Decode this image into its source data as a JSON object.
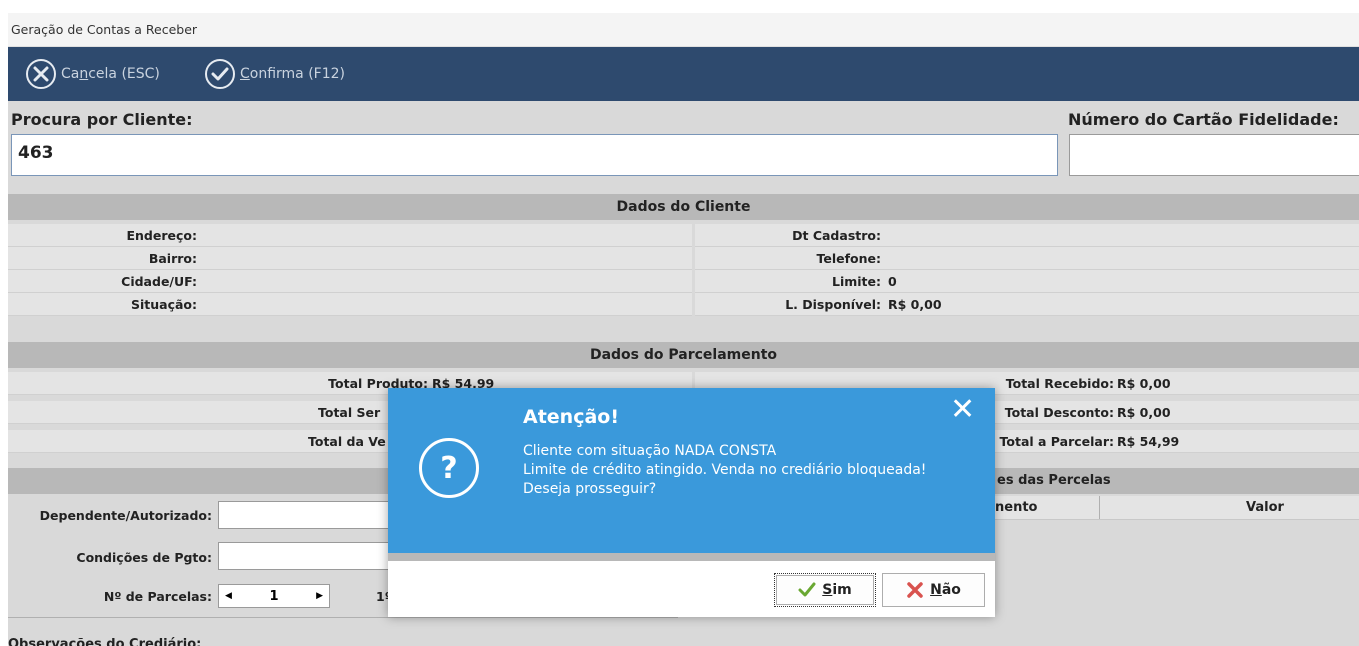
{
  "window": {
    "title": "Geração de Contas a Receber"
  },
  "toolbar": {
    "cancel": {
      "pre": "Ca",
      "accel": "n",
      "post": "cela (ESC)"
    },
    "confirm": {
      "pre": "",
      "accel": "C",
      "post": "onfirma (F12)"
    }
  },
  "search": {
    "client_label": "Procura por Cliente:",
    "client_value": "463",
    "card_label": "Número do Cartão Fidelidade:",
    "card_value": ""
  },
  "client_section": {
    "header": "Dados do Cliente",
    "left": [
      {
        "label": "Endereço:",
        "value": ""
      },
      {
        "label": "Bairro:",
        "value": ""
      },
      {
        "label": "Cidade/UF:",
        "value": ""
      },
      {
        "label": "Situação:",
        "value": ""
      }
    ],
    "right": [
      {
        "label": "Dt Cadastro:",
        "value": ""
      },
      {
        "label": "Telefone:",
        "value": ""
      },
      {
        "label": "Limite:",
        "value": "0"
      },
      {
        "label": "L. Disponível:",
        "value": "R$ 0,00"
      }
    ]
  },
  "installment_section": {
    "header": "Dados do Parcelamento",
    "left": [
      {
        "label": "Total Produto:",
        "value": "R$ 54,99"
      },
      {
        "label": "Total Ser",
        "value": ""
      },
      {
        "label": "Total da Ve",
        "value": ""
      }
    ],
    "right": [
      {
        "label": "Total Recebido:",
        "value": "R$ 0,00"
      },
      {
        "label": "Total Desconto:",
        "value": "R$ 0,00"
      },
      {
        "label": "Total a Parcelar:",
        "value": "R$ 54,99"
      }
    ],
    "parcel_table": {
      "title": "es das Percelas",
      "col_due": "nento",
      "col_value": "Valor"
    }
  },
  "form": {
    "dependent_label": "Dependente/Autorizado:",
    "payment_label": "Condições de Pgto:",
    "parcels_label": "Nº de Parcelas:",
    "parcels_value": "1",
    "first_label": "1º",
    "notes_label": "Observações do Crediário:"
  },
  "dialog": {
    "title": "Atenção!",
    "line1": "Cliente com situação NADA CONSTA",
    "line2": "Limite de crédito atingido. Venda no crediário bloqueada!",
    "line3": "Deseja prosseguir?",
    "yes": {
      "accel": "S",
      "post": "im"
    },
    "no": {
      "accel": "N",
      "post": "ão"
    }
  },
  "colors": {
    "toolbar": "#2e4a6e",
    "dialog": "#3a99db",
    "section": "#b8b8b8"
  }
}
